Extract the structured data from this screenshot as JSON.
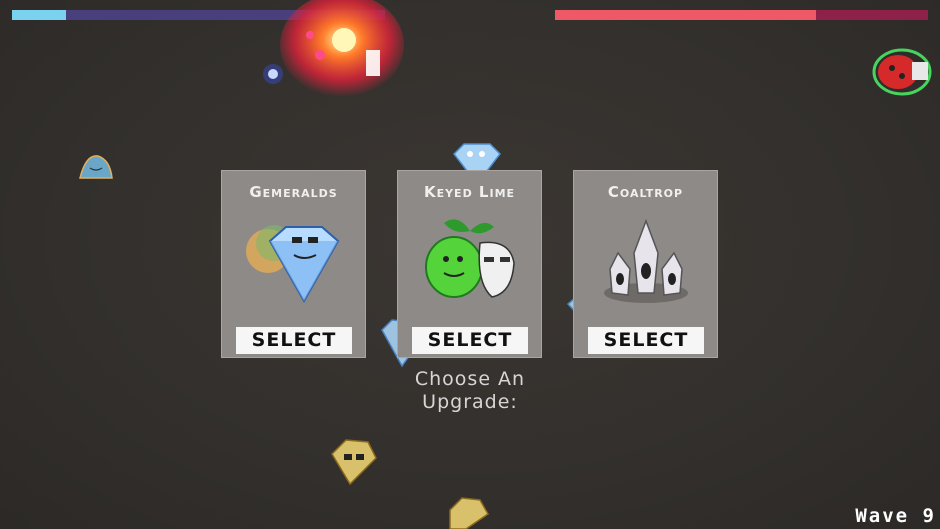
{
  "hud": {
    "xp_fill_fraction": 0.145,
    "hp_fill_fraction": 0.7
  },
  "upgrades": [
    {
      "title": "Gemeralds",
      "button_label": "SELECT"
    },
    {
      "title": "Keyed Lime",
      "button_label": "SELECT"
    },
    {
      "title": "Coaltrop",
      "button_label": "SELECT"
    }
  ],
  "prompt": {
    "line1": "Choose An",
    "line2": "Upgrade:"
  },
  "wave_label": "Wave 9",
  "icons": [
    "gemerald-icon",
    "keyed-lime-icon",
    "coaltrop-icon",
    "explosion-sprite",
    "ladybug-enemy",
    "diamond-enemy",
    "golden-gem-enemy",
    "blue-orb-projectile",
    "slime-enemy"
  ],
  "colors": {
    "xp_fill": "#7ad1f0",
    "xp_track": "#4a3f7d",
    "hp_fill": "#ee5867",
    "hp_track": "#8e2148",
    "card_bg": "#8d8a88"
  }
}
